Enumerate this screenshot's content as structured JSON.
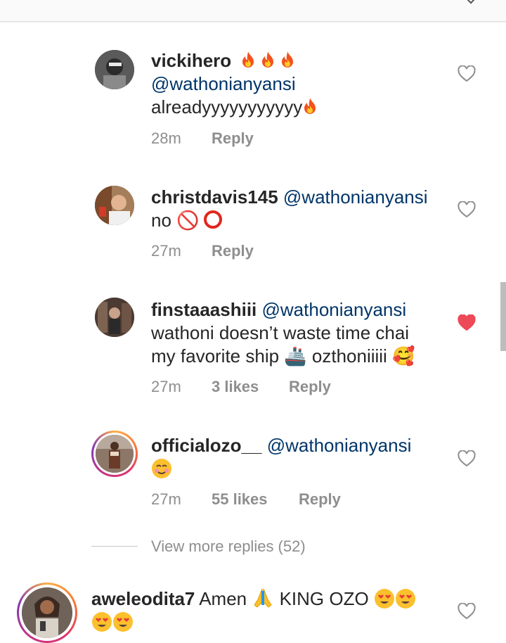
{
  "comments": [
    {
      "username": "vickihero",
      "mention": "@wathonianyansi",
      "text": "alreadyyyyyyyyyyy",
      "time": "28m",
      "likes": "",
      "reply": "Reply",
      "liked": false
    },
    {
      "username": "christdavis145",
      "mention": "@wathonianyansi",
      "text": "no 🚫",
      "time": "27m",
      "likes": "",
      "reply": "Reply",
      "liked": false
    },
    {
      "username": "finstaaashiii",
      "mention": "@wathonianyansi",
      "text_line1": "wathoni doesn’t waste time chai",
      "text_line2": "my favorite ship 🚢 ozthoniiiii 🥰",
      "time": "27m",
      "likes": "3 likes",
      "reply": "Reply",
      "liked": true
    },
    {
      "username": "officialozo__",
      "mention": "@wathonianyansi",
      "text": "",
      "time": "27m",
      "likes": "55 likes",
      "reply": "Reply",
      "liked": false
    },
    {
      "username": "aweleodita7",
      "text": "Amen",
      "text2": "KING OZO",
      "liked": false
    }
  ],
  "view_more": "View more replies (52)",
  "colors": {
    "mention": "#003569",
    "meta": "#8e8e8e",
    "liked_heart": "#ed4956"
  }
}
